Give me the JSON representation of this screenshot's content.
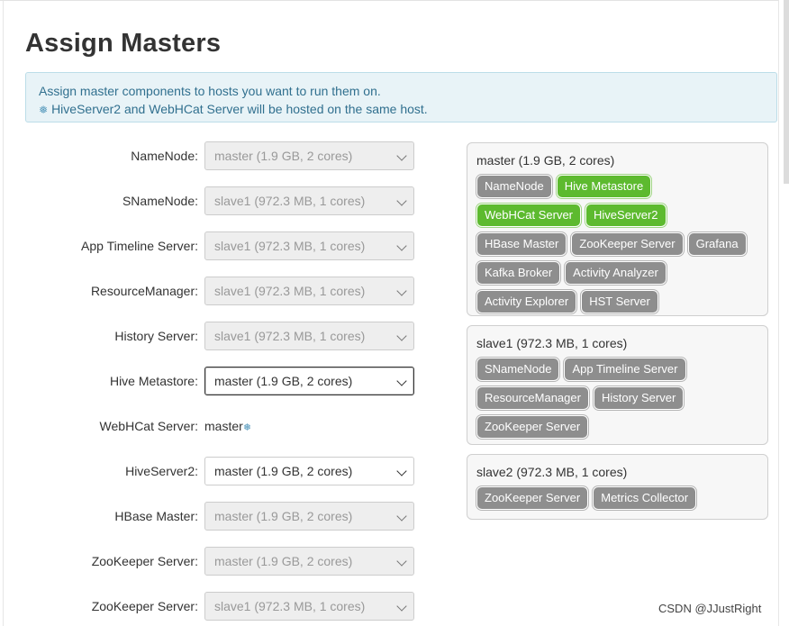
{
  "page": {
    "title": "Assign Masters"
  },
  "alert": {
    "line1": "Assign master components to hosts you want to run them on.",
    "line2": "HiveServer2 and WebHCat Server will be hosted on the same host.",
    "icon": "snowflake-icon"
  },
  "assignments": [
    {
      "label": "NameNode:",
      "value": "master (1.9 GB, 2 cores)"
    },
    {
      "label": "SNameNode:",
      "value": "slave1 (972.3 MB, 1 cores)"
    },
    {
      "label": "App Timeline Server:",
      "value": "slave1 (972.3 MB, 1 cores)"
    },
    {
      "label": "ResourceManager:",
      "value": "slave1 (972.3 MB, 1 cores)"
    },
    {
      "label": "History Server:",
      "value": "slave1 (972.3 MB, 1 cores)"
    },
    {
      "label": "Hive Metastore:",
      "value": "master (1.9 GB, 2 cores)"
    },
    {
      "label": "WebHCat Server:",
      "value": "master"
    },
    {
      "label": "HiveServer2:",
      "value": "master (1.9 GB, 2 cores)"
    },
    {
      "label": "HBase Master:",
      "value": "master (1.9 GB, 2 cores)"
    },
    {
      "label": "ZooKeeper Server:",
      "value": "master (1.9 GB, 2 cores)"
    },
    {
      "label": "ZooKeeper Server:",
      "value": "slave1 (972.3 MB, 1 cores)"
    }
  ],
  "hosts": [
    {
      "title": "master (1.9 GB, 2 cores)",
      "components": [
        "NameNode",
        "Hive Metastore",
        "WebHCat Server",
        "HiveServer2",
        "HBase Master",
        "ZooKeeper Server",
        "Grafana",
        "Kafka Broker",
        "Activity Analyzer",
        "Activity Explorer",
        "HST Server"
      ]
    },
    {
      "title": "slave1 (972.3 MB, 1 cores)",
      "components": [
        "SNameNode",
        "App Timeline Server",
        "ResourceManager",
        "History Server",
        "ZooKeeper Server"
      ]
    },
    {
      "title": "slave2 (972.3 MB, 1 cores)",
      "components": [
        "ZooKeeper Server",
        "Metrics Collector"
      ]
    }
  ],
  "colors": {
    "highlight_badge": "#5dba2f",
    "default_badge": "#8e8e8e",
    "alert_bg": "#e8f3f7",
    "alert_text": "#31708f"
  },
  "watermark": "CSDN @JJustRight"
}
